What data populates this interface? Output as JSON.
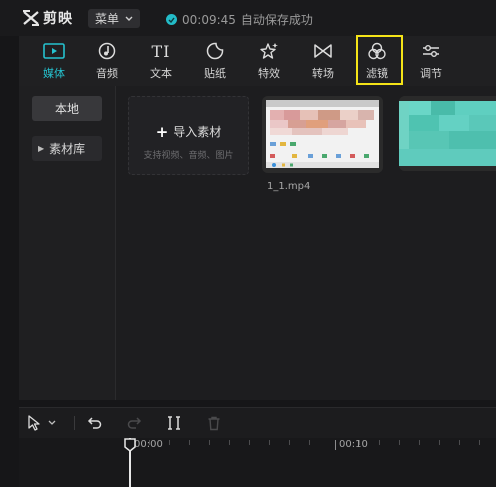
{
  "app": {
    "name": "剪映"
  },
  "titlebar": {
    "menu_label": "菜单",
    "save_time": "00:09:45",
    "save_text": "自动保存成功"
  },
  "toolbar": {
    "tabs": [
      {
        "label": "媒体",
        "icon": "media-icon",
        "active": true
      },
      {
        "label": "音频",
        "icon": "audio-icon"
      },
      {
        "label": "文本",
        "icon": "text-icon"
      },
      {
        "label": "贴纸",
        "icon": "sticker-icon"
      },
      {
        "label": "特效",
        "icon": "effects-icon"
      },
      {
        "label": "转场",
        "icon": "transition-icon"
      },
      {
        "label": "滤镜",
        "icon": "filter-icon",
        "highlighted": true
      },
      {
        "label": "调节",
        "icon": "adjust-icon"
      }
    ],
    "text_icon_glyph": "TI",
    "highlight_color": "#f5e418",
    "accent_color": "#25c2cf"
  },
  "left_panel": {
    "local_label": "本地",
    "library_label": "素材库"
  },
  "media": {
    "import_label": "导入素材",
    "import_sub": "支持视频、音频、图片",
    "clips": [
      {
        "label": "1_1.mp4"
      }
    ]
  },
  "timeline": {
    "tools": [
      "select-icon",
      "undo-icon",
      "redo-icon",
      "split-icon",
      "delete-icon"
    ],
    "ruler": {
      "start": "00:00",
      "mark": "00:10"
    }
  }
}
